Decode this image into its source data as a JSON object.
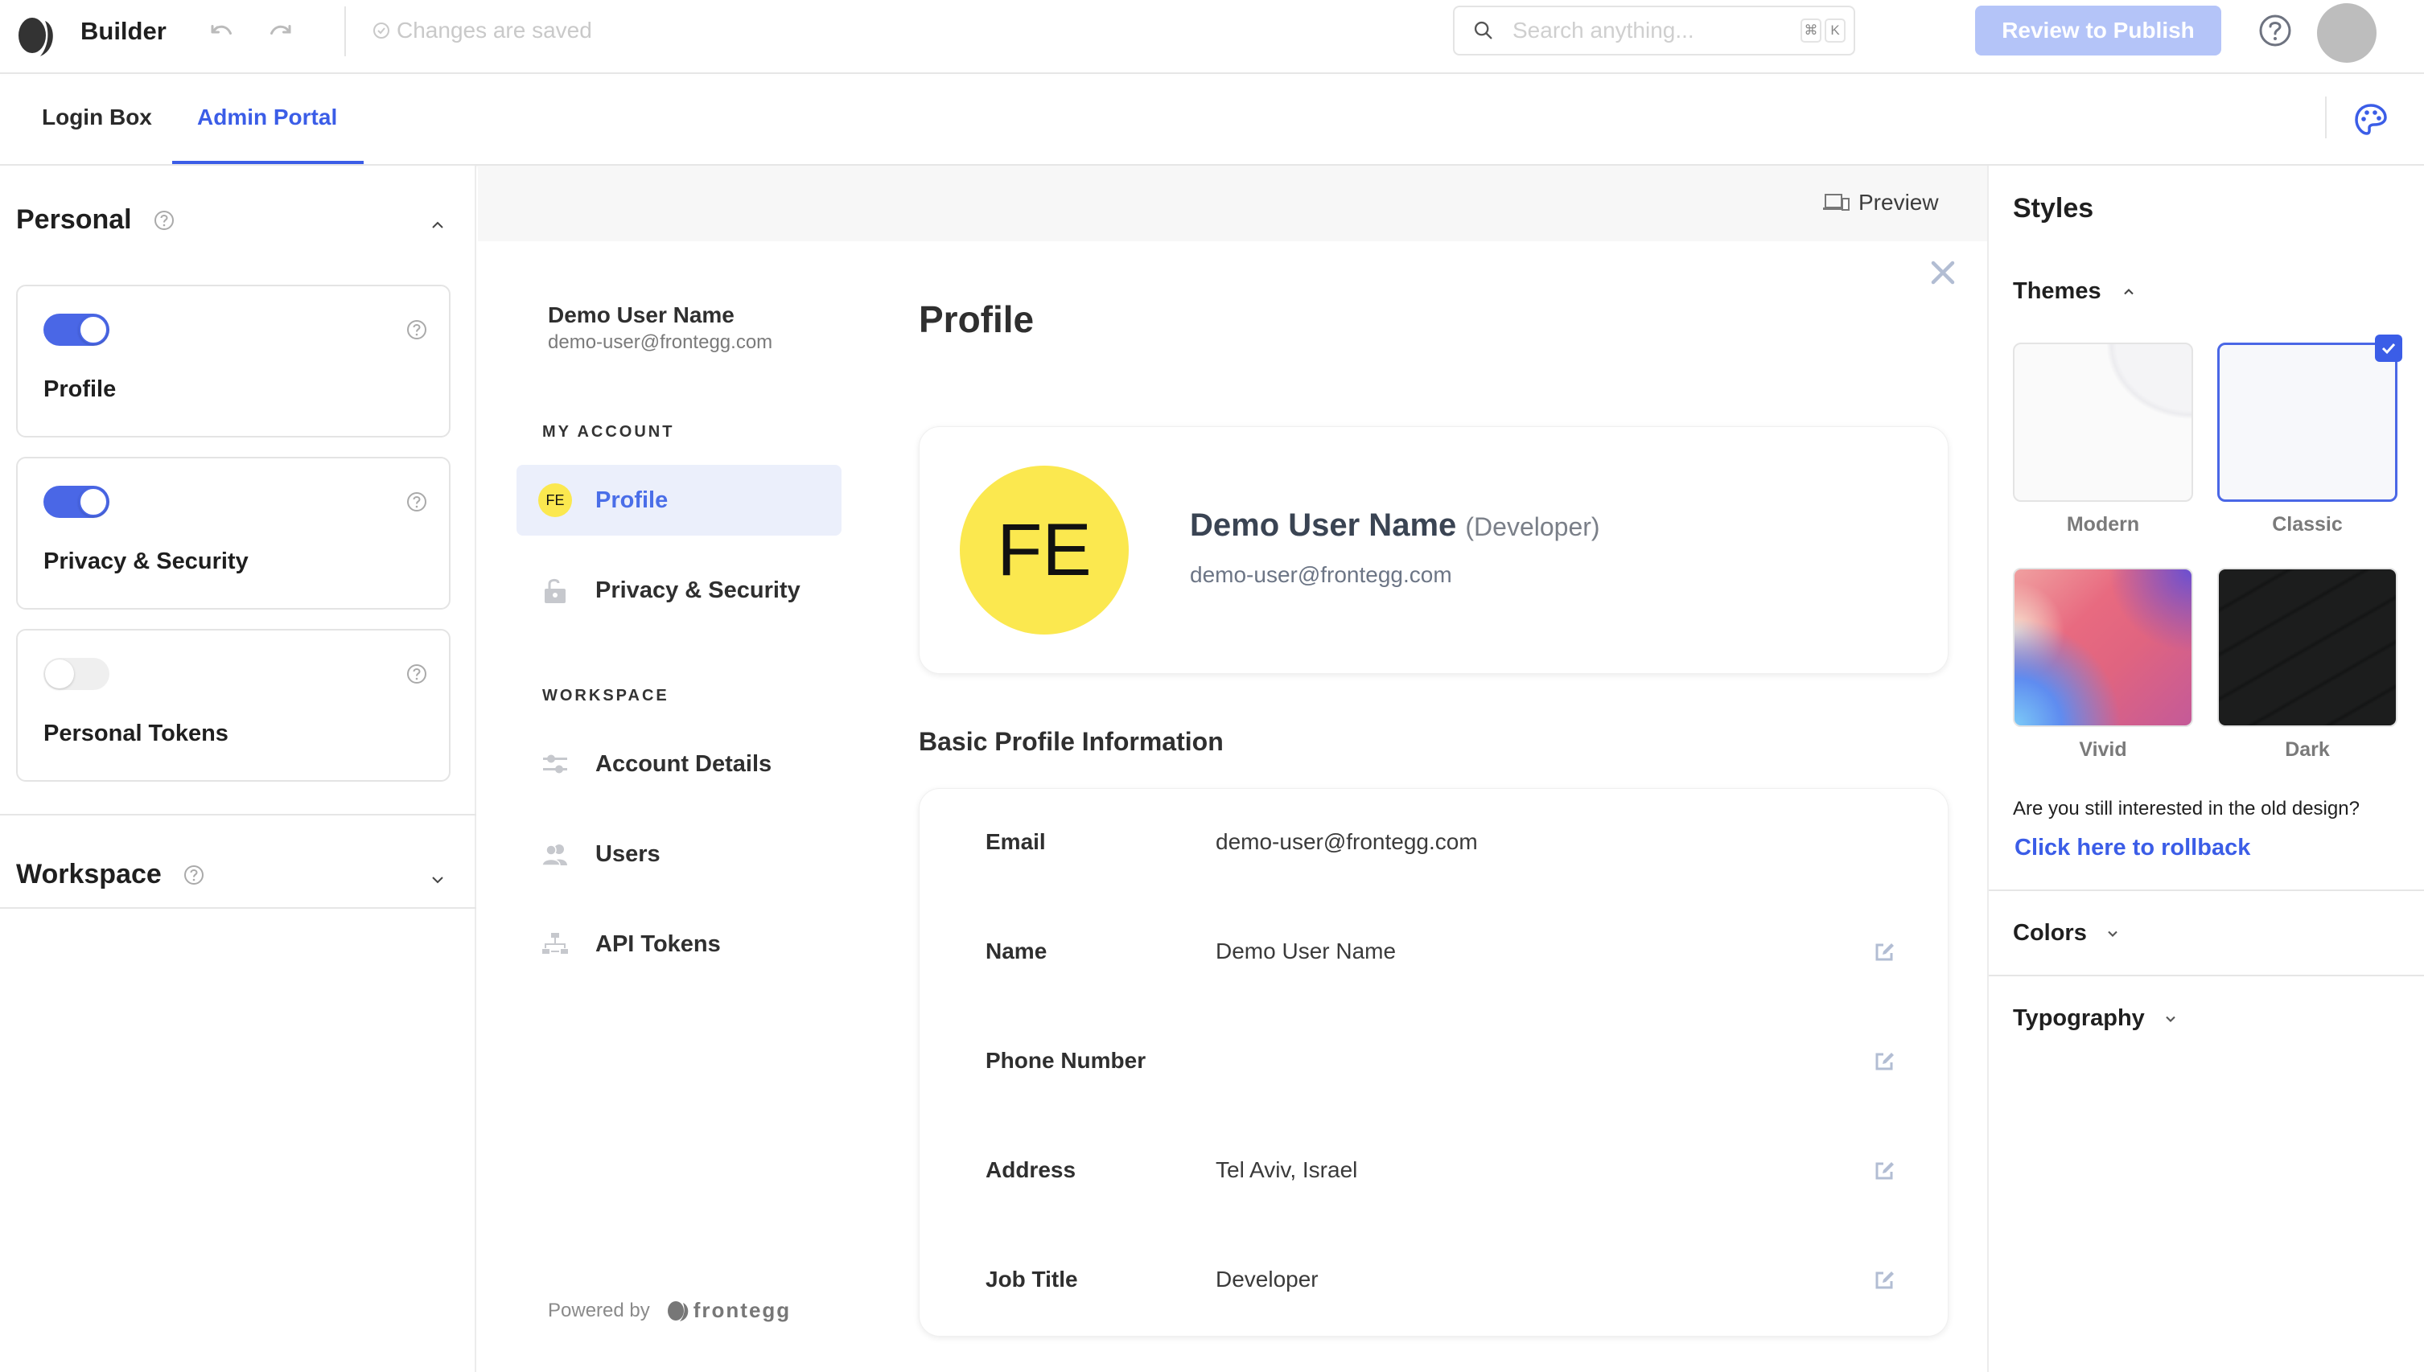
{
  "topbar": {
    "app_title": "Builder",
    "save_status": "Changes are saved",
    "search_placeholder": "Search anything...",
    "shortcut_keys": [
      "⌘",
      "K"
    ],
    "publish_label": "Review to Publish"
  },
  "tabs": [
    {
      "label": "Login Box",
      "active": false
    },
    {
      "label": "Admin Portal",
      "active": true
    }
  ],
  "left_panel": {
    "personal": {
      "title": "Personal",
      "expanded": true,
      "features": [
        {
          "label": "Profile",
          "enabled": true
        },
        {
          "label": "Privacy & Security",
          "enabled": true
        },
        {
          "label": "Personal Tokens",
          "enabled": false
        }
      ]
    },
    "workspace": {
      "title": "Workspace",
      "expanded": false
    }
  },
  "preview": {
    "preview_label": "Preview",
    "user": {
      "name": "Demo User Name",
      "email": "demo-user@frontegg.com",
      "initials": "FE",
      "role": "(Developer)"
    },
    "nav": {
      "my_account_heading": "MY ACCOUNT",
      "my_account_items": [
        {
          "label": "Profile",
          "icon": "avatar",
          "active": true
        },
        {
          "label": "Privacy & Security",
          "icon": "lock-icon",
          "active": false
        }
      ],
      "workspace_heading": "WORKSPACE",
      "workspace_items": [
        {
          "label": "Account Details",
          "icon": "sliders-icon"
        },
        {
          "label": "Users",
          "icon": "users-icon"
        },
        {
          "label": "API Tokens",
          "icon": "hierarchy-icon"
        }
      ]
    },
    "powered_by": "Powered by",
    "brand": "frontegg",
    "page_title": "Profile",
    "basic_info_title": "Basic Profile Information",
    "info_rows": [
      {
        "label": "Email",
        "value": "demo-user@frontegg.com",
        "editable": false
      },
      {
        "label": "Name",
        "value": "Demo User Name",
        "editable": true
      },
      {
        "label": "Phone Number",
        "value": "",
        "editable": true
      },
      {
        "label": "Address",
        "value": "Tel Aviv, Israel",
        "editable": true
      },
      {
        "label": "Job Title",
        "value": "Developer",
        "editable": true
      }
    ]
  },
  "right_panel": {
    "title": "Styles",
    "themes_heading": "Themes",
    "themes": [
      {
        "label": "Modern",
        "selected": false
      },
      {
        "label": "Classic",
        "selected": true
      },
      {
        "label": "Vivid",
        "selected": false
      },
      {
        "label": "Dark",
        "selected": false
      }
    ],
    "rollback_question": "Are you still interested in the old design?",
    "rollback_link": "Click here to rollback",
    "colors_heading": "Colors",
    "typography_heading": "Typography"
  },
  "colors": {
    "accent": "#3b5de7",
    "avatar": "#fbe84f",
    "publish_disabled": "#b4c4f8"
  }
}
